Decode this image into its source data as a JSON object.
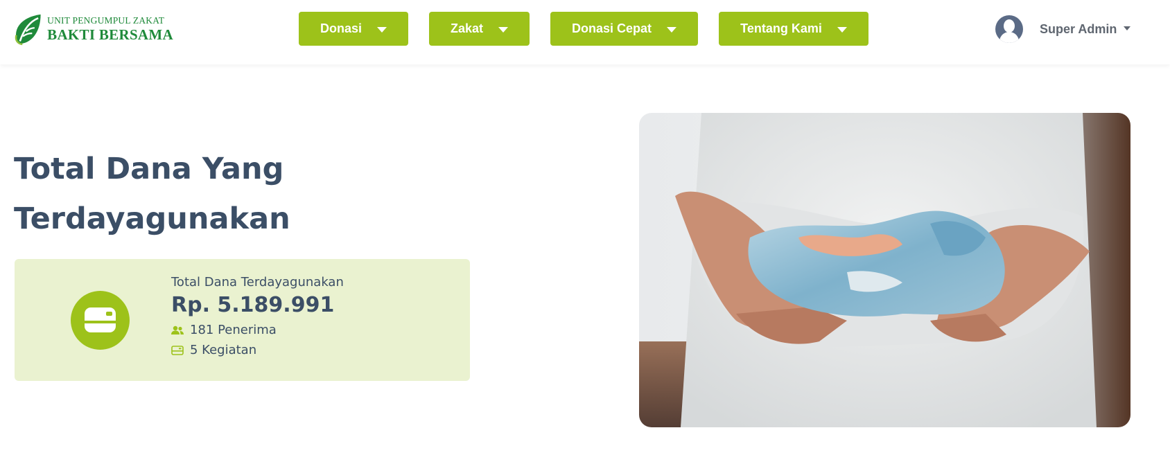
{
  "header": {
    "logo": {
      "line1": "UNIT PENGUMPUL ZAKAT",
      "line2": "BAKTI BERSAMA",
      "icon": "leaf-icon",
      "color": "#1f8a3a"
    },
    "nav": [
      {
        "label": "Donasi",
        "icon": "chevron-down-icon"
      },
      {
        "label": "Zakat",
        "icon": "chevron-down-icon"
      },
      {
        "label": "Donasi Cepat",
        "icon": "chevron-down-icon"
      },
      {
        "label": "Tentang Kami",
        "icon": "chevron-down-icon"
      }
    ],
    "user": {
      "name": "Super Admin",
      "icon": "avatar-icon"
    },
    "accent_color": "#9dc21a"
  },
  "main": {
    "title_line1": "Total Dana Yang",
    "title_line2": "Terdayagunakan",
    "card": {
      "label": "Total Dana Terdayagunakan",
      "amount": "Rp. 5.189.991",
      "icon": "wallet-icon",
      "stats": [
        {
          "icon": "users-icon",
          "text": "181 Penerima"
        },
        {
          "icon": "card-icon",
          "text": "5 Kegiatan"
        }
      ],
      "background_color": "#eaf2d0"
    },
    "photo": {
      "subject": "hands-holding-money-photo"
    }
  }
}
